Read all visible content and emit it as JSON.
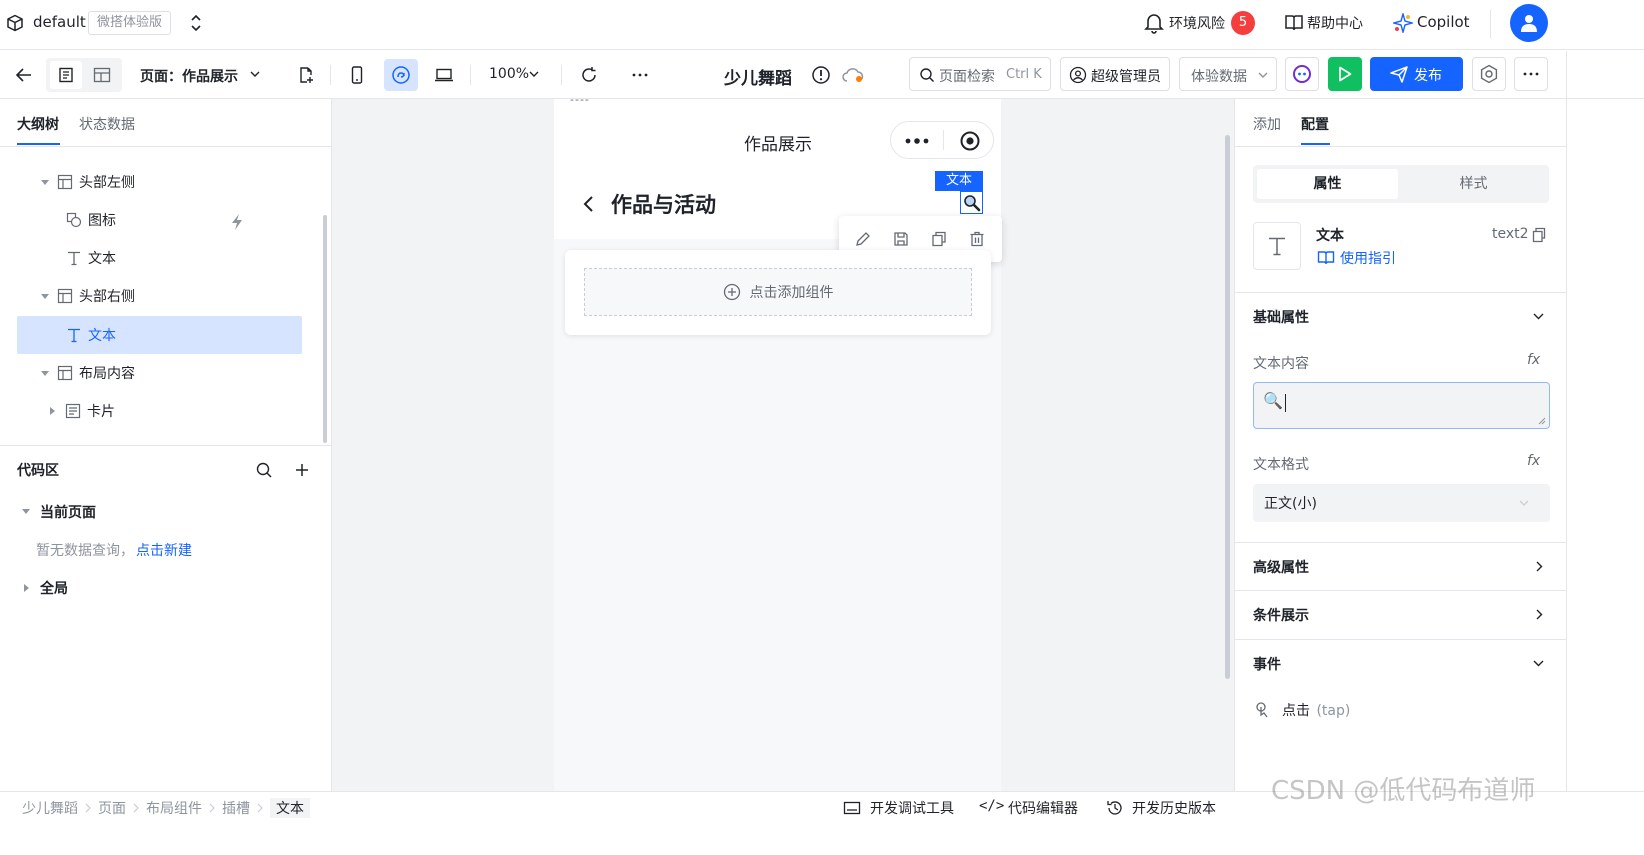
{
  "app": {
    "workspace": "default",
    "edition_badge": "微搭体验版",
    "env_risk_label": "环境风险",
    "env_risk_count": "5",
    "help_label": "帮助中心",
    "copilot_label": "Copilot"
  },
  "toolbar": {
    "page_label": "页面：作品展示",
    "zoom": "100%",
    "app_name": "少儿舞蹈",
    "search_placeholder": "页面检索",
    "search_shortcut": "Ctrl K",
    "role_label": "超级管理员",
    "data_mode_label": "体验数据",
    "publish_label": "发布"
  },
  "left": {
    "tabs": [
      "大纲树",
      "状态数据"
    ],
    "tree": [
      {
        "label": "头部左侧"
      },
      {
        "label": "图标"
      },
      {
        "label": "文本"
      },
      {
        "label": "头部右侧"
      },
      {
        "label": "文本"
      },
      {
        "label": "布局内容"
      },
      {
        "label": "卡片"
      }
    ],
    "code_area": {
      "title": "代码区",
      "current_page": "当前页面",
      "empty_text": "暂无数据查询，",
      "create_link": "点击新建",
      "global": "全局"
    }
  },
  "canvas": {
    "nav_title": "作品展示",
    "back_title": "作品与活动",
    "selected_tag": "文本",
    "add_component": "点击添加组件",
    "top_marker": "----"
  },
  "right": {
    "tabs": [
      "添加",
      "配置"
    ],
    "subtabs": [
      "属性",
      "样式"
    ],
    "component_name": "文本",
    "component_id": "text2",
    "usage_guide": "使用指引",
    "basic_props": "基础属性",
    "text_content_label": "文本内容",
    "text_content_value": "🔍",
    "text_format_label": "文本格式",
    "text_format_value": "正文(小)",
    "advanced_props": "高级属性",
    "conditional_display": "条件展示",
    "events": "事件",
    "event_name": "点击",
    "event_code": "(tap)",
    "fx_label": "fx"
  },
  "status": {
    "breadcrumbs": [
      "少儿舞蹈",
      "页面",
      "布局组件",
      "插槽",
      "文本"
    ],
    "dev_tools": "开发调试工具",
    "code_editor": "代码编辑器",
    "dev_history": "开发历史版本",
    "code_icon_text": "</>"
  },
  "watermark": "CSDN @低代码布道师",
  "colors": {
    "primary": "#1664ff",
    "run_green": "#0fbf60",
    "badge_red": "#f53f3f",
    "selected_bg": "#d6e4ff"
  }
}
